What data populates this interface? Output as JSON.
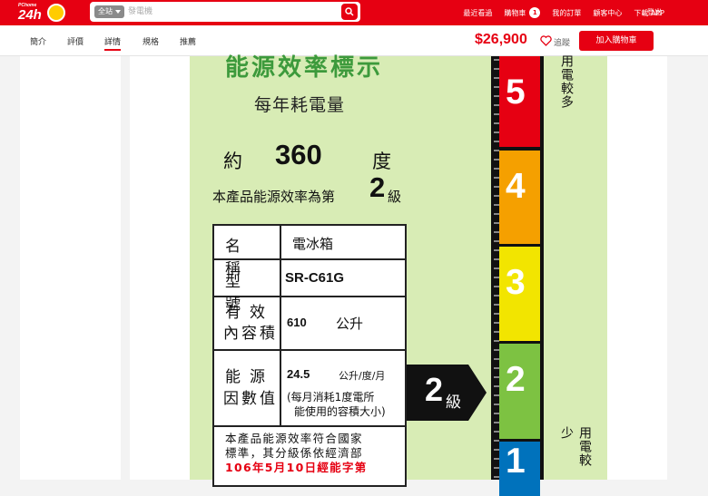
{
  "header": {
    "logo_small": "PChome",
    "logo_main": "24h",
    "search_scope": "全站",
    "search_placeholder": "發電機",
    "links": [
      "最近看過",
      "購物車",
      "我的訂單",
      "顧客中心",
      "下載 APP"
    ],
    "cart_count": "1",
    "logout": "登出"
  },
  "subnav": {
    "tabs": [
      "簡介",
      "評價",
      "詳情",
      "規格",
      "推薦"
    ],
    "active_tab": "詳情",
    "price": "$26,900",
    "track_label": "追蹤",
    "add_to_cart": "加入購物車"
  },
  "energy_label": {
    "title": "能源效率標示",
    "subtitle": "每年耗電量",
    "approx": "約",
    "annual_kwh": "360",
    "unit_du": "度",
    "efficiency_prefix": "本產品能源效率為第",
    "efficiency_grade": "2",
    "efficiency_suffix": "級",
    "table": {
      "name_key": "名稱",
      "name_value": "電冰箱",
      "model_key": "型號",
      "model_value": "SR-C61G",
      "capacity_key_1": "有效",
      "capacity_key_2": "內容積",
      "capacity_value": "610",
      "capacity_unit": "公升",
      "factor_key_1": "能源",
      "factor_key_2": "因數值",
      "factor_value": "24.5",
      "factor_unit": "公升/度/月",
      "factor_note_1": "(每月消耗1度電所",
      "factor_note_2": "能使用的容積大小)",
      "note_line1": "本產品能源效率符合國家",
      "note_line2": "標準，其分級係依經濟部",
      "note_line3": "106年5月10日經能字第"
    },
    "arrow_grade": "2",
    "arrow_suffix": "級",
    "scale_grades": [
      "5",
      "4",
      "3",
      "2",
      "1"
    ],
    "scale_colors": [
      "#e60012",
      "#f5a000",
      "#f2e500",
      "#7dc242",
      "#0072bc"
    ],
    "more_label": "用電較多",
    "less_label": "用電較少"
  }
}
